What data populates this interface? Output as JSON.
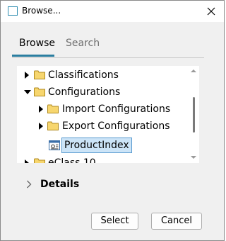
{
  "window": {
    "title": "Browse..."
  },
  "tabs": [
    {
      "label": "Browse",
      "active": true
    },
    {
      "label": "Search",
      "active": false
    }
  ],
  "tree": {
    "items": [
      {
        "label": "Classifications",
        "expander": "collapsed",
        "icon": "folder-icon",
        "level": 0
      },
      {
        "label": "Configurations",
        "expander": "expanded",
        "icon": "folder-icon",
        "level": 0
      },
      {
        "label": "Import Configurations",
        "expander": "collapsed",
        "icon": "folder-icon",
        "level": 1
      },
      {
        "label": "Export Configurations",
        "expander": "collapsed",
        "icon": "folder-icon",
        "level": 1
      },
      {
        "label": "ProductIndex",
        "expander": "none",
        "icon": "document-icon",
        "level": 1,
        "selected": true
      },
      {
        "label": "eClass 10",
        "expander": "collapsed",
        "icon": "folder-icon",
        "level": 0
      }
    ]
  },
  "details": {
    "label": "Details"
  },
  "buttons": {
    "select": "Select",
    "cancel": "Cancel"
  },
  "colors": {
    "accent": "#2b7ea0",
    "selection": "#cce4f7",
    "selection_border": "#5a9bd0",
    "folder": "#f7d66e"
  }
}
